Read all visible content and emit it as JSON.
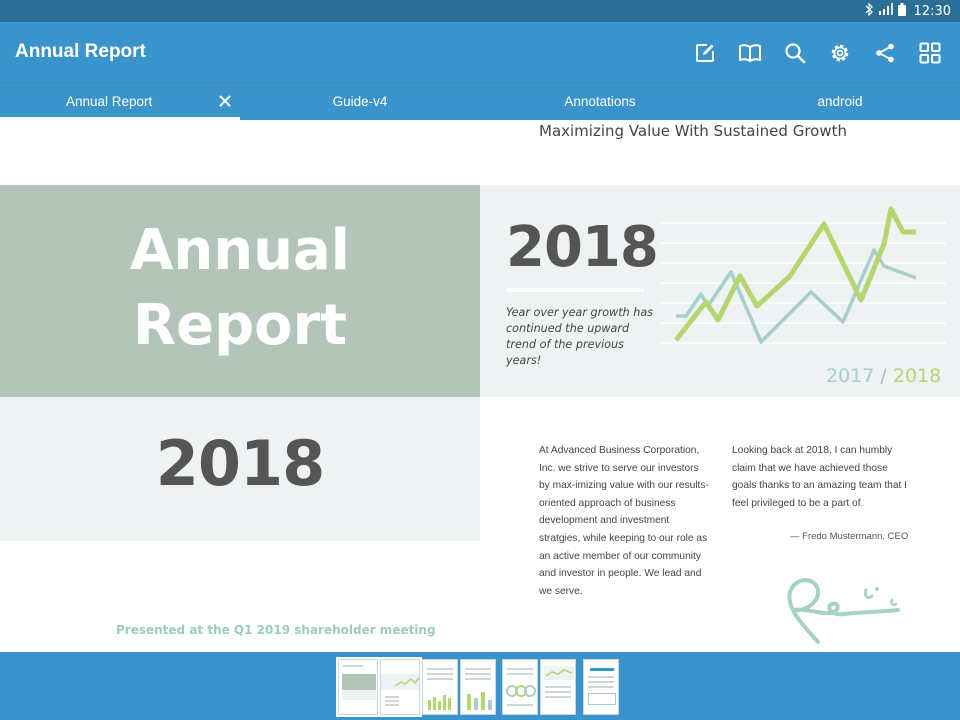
{
  "status_bar": {
    "time": "12:30"
  },
  "app_bar": {
    "title": "Annual Report",
    "tools": [
      "edit-icon",
      "book-icon",
      "search-icon",
      "settings-icon",
      "share-icon",
      "grid-icon"
    ]
  },
  "tabs": [
    {
      "label": "Annual Report",
      "active": true
    },
    {
      "label": "Guide-v4",
      "active": false
    },
    {
      "label": "Annotations",
      "active": false
    },
    {
      "label": "android",
      "active": false
    }
  ],
  "document": {
    "headline": "Maximizing Value With Sustained Growth",
    "cover_title_line1": "Annual",
    "cover_title_line2": "Report",
    "year": "2018",
    "growth_text": "Year over year growth has continued the upward trend of the previous years!",
    "legend_2017": "2017",
    "legend_separator": "/",
    "legend_2018": "2018",
    "lower_year": "2018",
    "paragraph1": "At Advanced Business Corporation, Inc. we strive to serve our investors  by max-imizing value with our results-oriented approach of business development and investment stratgies, while keeping to our role as an active member of our community and investor in people. We lead and we serve.",
    "paragraph2": "Looking back at 2018, I can humbly claim that we have achieved those goals thanks to an amazing team that I feel privileged to be a part of.",
    "attribution": "— Fredo Mustermann, CEO",
    "presented": "Presented at the Q1 2019 shareholder meeting"
  },
  "colors": {
    "app_bar": "#3a94cb",
    "status_bar": "#2c6f96",
    "cover_green": "#b3c5b9",
    "panel": "#eef2f3",
    "line_2017": "#a5cfca",
    "line_2018": "#b5d56e"
  },
  "thumbnails": {
    "count": 7,
    "selected": [
      1,
      2
    ]
  }
}
